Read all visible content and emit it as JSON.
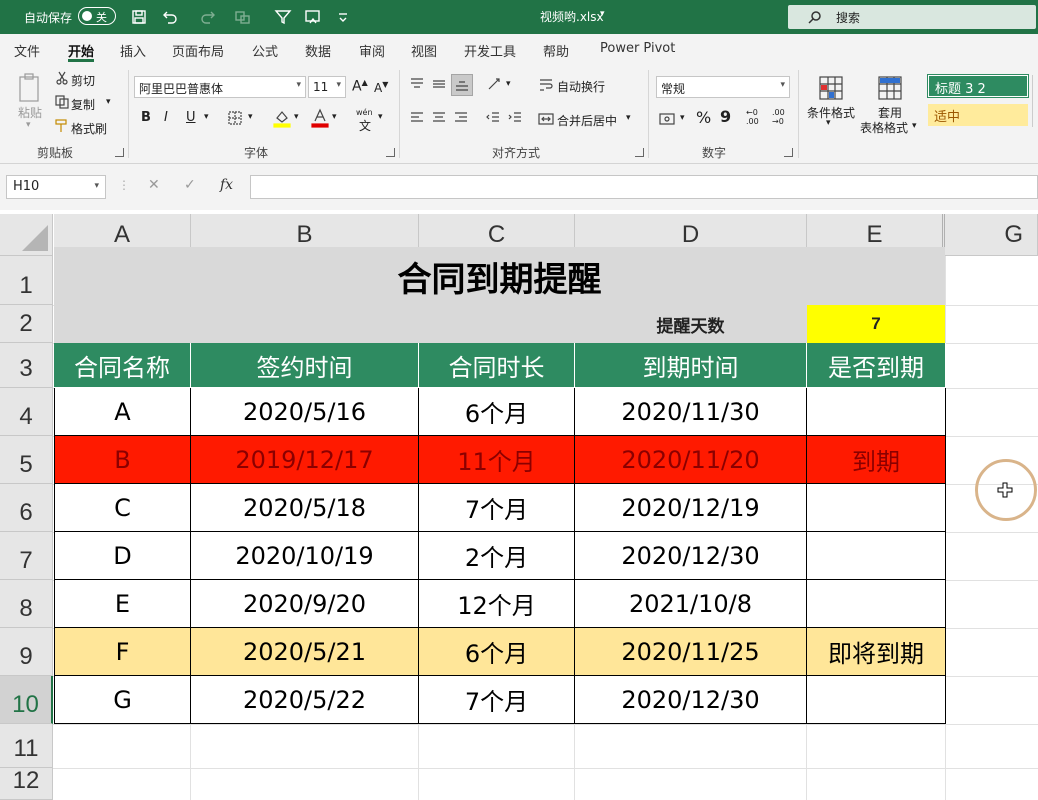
{
  "titlebar": {
    "autosave_label": "自动保存",
    "autosave_state": "关",
    "filename": "视频哟.xlsx",
    "search_label": "搜索"
  },
  "tabs": [
    "文件",
    "开始",
    "插入",
    "页面布局",
    "公式",
    "数据",
    "审阅",
    "视图",
    "开发工具",
    "帮助",
    "Power Pivot"
  ],
  "active_tab": "开始",
  "ribbon": {
    "clipboard": {
      "paste": "粘贴",
      "cut": "剪切",
      "copy": "复制",
      "format_painter": "格式刷",
      "label": "剪贴板"
    },
    "font": {
      "name": "阿里巴巴普惠体",
      "size": "11",
      "bold": "B",
      "italic": "I",
      "underline": "U",
      "label": "字体",
      "phonetic": "wén"
    },
    "alignment": {
      "wrap": "自动换行",
      "merge": "合并后居中",
      "label": "对齐方式"
    },
    "number": {
      "format": "常规",
      "percent": "%",
      "comma": "9",
      "label": "数字"
    },
    "styles": {
      "conditional": "条件格式",
      "table_line1": "套用",
      "table_line2": "表格格式",
      "style1": "标题 3 2",
      "style2": "适中"
    }
  },
  "formula_bar": {
    "name_box": "H10",
    "fx": "fx",
    "value": ""
  },
  "columns": [
    "A",
    "B",
    "C",
    "D",
    "E",
    "G"
  ],
  "rows": [
    "1",
    "2",
    "3",
    "4",
    "5",
    "6",
    "7",
    "8",
    "9",
    "10",
    "11",
    "12"
  ],
  "selected_row": "10",
  "sheet": {
    "title": "合同到期提醒",
    "remind_label": "提醒天数",
    "remind_days": "7",
    "headers": [
      "合同名称",
      "签约时间",
      "合同时长",
      "到期时间",
      "是否到期"
    ],
    "records": [
      {
        "name": "A",
        "sign": "2020/5/16",
        "duration": "6个月",
        "expire": "2020/11/30",
        "status": "",
        "state": "normal"
      },
      {
        "name": "B",
        "sign": "2019/12/17",
        "duration": "11个月",
        "expire": "2020/11/20",
        "status": "到期",
        "state": "expired"
      },
      {
        "name": "C",
        "sign": "2020/5/18",
        "duration": "7个月",
        "expire": "2020/12/19",
        "status": "",
        "state": "normal"
      },
      {
        "name": "D",
        "sign": "2020/10/19",
        "duration": "2个月",
        "expire": "2020/12/30",
        "status": "",
        "state": "normal"
      },
      {
        "name": "E",
        "sign": "2020/9/20",
        "duration": "12个月",
        "expire": "2021/10/8",
        "status": "",
        "state": "normal"
      },
      {
        "name": "F",
        "sign": "2020/5/21",
        "duration": "6个月",
        "expire": "2020/11/25",
        "status": "即将到期",
        "state": "soon"
      },
      {
        "name": "G",
        "sign": "2020/5/22",
        "duration": "7个月",
        "expire": "2020/12/30",
        "status": "",
        "state": "normal"
      }
    ]
  },
  "colors": {
    "excel_green": "#217346",
    "header_fill": "#2e8b61",
    "expired_fill": "#ff1a00",
    "expired_text": "#8b0000",
    "soon_fill": "#ffe699",
    "remind_fill": "#ffff00",
    "title_fill": "#d9d9d9"
  }
}
